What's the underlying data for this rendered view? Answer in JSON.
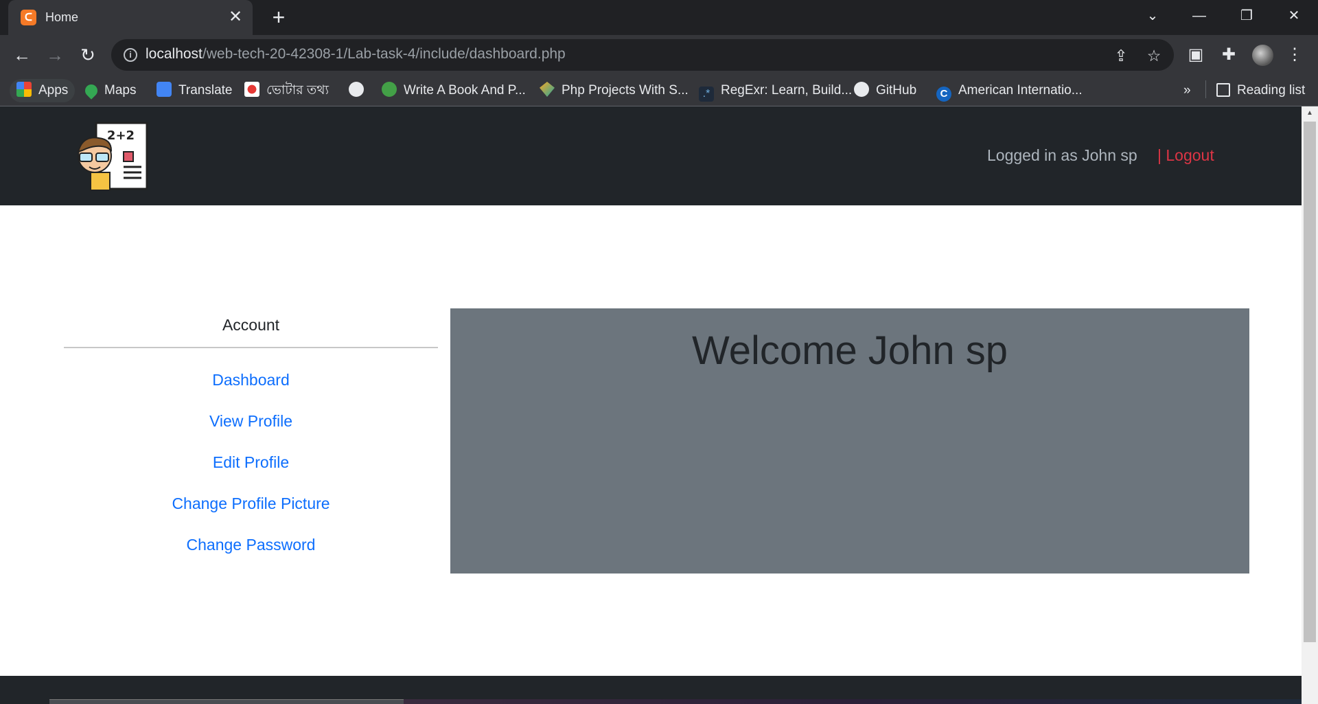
{
  "browser": {
    "tab_title": "Home",
    "new_tab_glyph": "+",
    "close_glyph": "✕",
    "url_host": "localhost",
    "url_path": "/web-tech-20-42308-1/Lab-task-4/include/dashboard.php",
    "bookmarks": [
      {
        "label": "Apps",
        "icon": "apps-grid-icon"
      },
      {
        "label": "Maps",
        "icon": "maps-icon"
      },
      {
        "label": "Translate",
        "icon": "translate-icon"
      },
      {
        "label": "ভোটার তথ্য",
        "icon": "election-commission-icon"
      },
      {
        "label": "",
        "icon": "globe-icon"
      },
      {
        "label": "Write A Book And P...",
        "icon": "write-book-icon"
      },
      {
        "label": "Php Projects With S...",
        "icon": "php-projects-icon"
      },
      {
        "label": "RegExr: Learn, Build...",
        "icon": "regexr-icon"
      },
      {
        "label": "GitHub",
        "icon": "github-icon"
      },
      {
        "label": "American Internatio...",
        "icon": "aiub-icon"
      }
    ],
    "overflow_glyph": "»",
    "reading_list_label": "Reading list"
  },
  "site": {
    "logged_in_text": "Logged in as John sp",
    "logout_text": "| Logout",
    "sidebar_title": "Account",
    "menu": [
      "Dashboard",
      "View Profile",
      "Edit Profile",
      "Change Profile Picture",
      "Change Password"
    ],
    "welcome_text": "Welcome John sp"
  },
  "colors": {
    "navbar_bg": "#212529",
    "link": "#0d6efd",
    "logout": "#dc3545",
    "welcome_bg": "#6c757d"
  }
}
